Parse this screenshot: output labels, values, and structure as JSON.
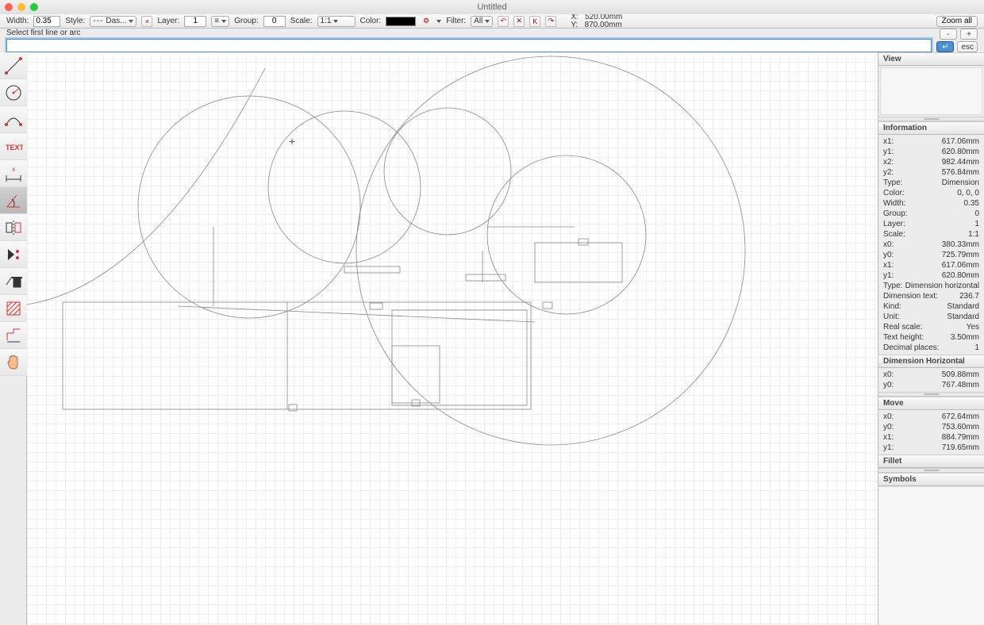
{
  "title": "Untitled",
  "toolbar": {
    "width_label": "Width:",
    "width_value": "0.35",
    "style_label": "Style:",
    "style_value": "Das...",
    "layer_label": "Layer:",
    "layer_value": "1",
    "group_label": "Group:",
    "group_value": "0",
    "scale_label": "Scale:",
    "scale_value": "1:1",
    "color_label": "Color:",
    "filter_label": "Filter:",
    "filter_value": "All",
    "coord_x_label": "X:",
    "coord_x_value": "520.00mm",
    "coord_y_label": "Y:",
    "coord_y_value": "870.00mm",
    "zoom_all": "Zoom all"
  },
  "prompt": {
    "text": "Select first line or arc",
    "minus": "-",
    "plus": "+",
    "esc": "esc"
  },
  "tools": [
    {
      "name": "line-tool"
    },
    {
      "name": "arc-tool"
    },
    {
      "name": "curve-tool"
    },
    {
      "name": "text-tool"
    },
    {
      "name": "dimension-tool"
    },
    {
      "name": "dimension-angle-tool"
    },
    {
      "name": "mirror-tool"
    },
    {
      "name": "edit-tool"
    },
    {
      "name": "delete-tool"
    },
    {
      "name": "hatch-tool"
    },
    {
      "name": "trim-tool"
    },
    {
      "name": "pan-tool"
    }
  ],
  "panels": {
    "view": "View",
    "information": "Information",
    "dimension_horizontal": "Dimension Horizontal",
    "move": "Move",
    "fillet": "Fillet",
    "symbols": "Symbols"
  },
  "info": [
    {
      "k": "x1:",
      "v": "617.06mm"
    },
    {
      "k": "y1:",
      "v": "620.80mm"
    },
    {
      "k": "x2:",
      "v": "982.44mm"
    },
    {
      "k": "y2:",
      "v": "576.84mm"
    },
    {
      "k": "Type:",
      "v": "Dimension"
    },
    {
      "k": "Color:",
      "v": "0, 0, 0"
    },
    {
      "k": "Width:",
      "v": "0.35"
    },
    {
      "k": "Group:",
      "v": "0"
    },
    {
      "k": "Layer:",
      "v": "1"
    },
    {
      "k": "Scale:",
      "v": "1:1"
    },
    {
      "k": "x0:",
      "v": "380.33mm"
    },
    {
      "k": "y0:",
      "v": "725.79mm"
    },
    {
      "k": "x1:",
      "v": "617.06mm"
    },
    {
      "k": "y1:",
      "v": "620.80mm"
    },
    {
      "k": "Type:",
      "v": "Dimension horizontal"
    },
    {
      "k": "Dimension text:",
      "v": "236.7"
    },
    {
      "k": "Kind:",
      "v": "Standard"
    },
    {
      "k": "Unit:",
      "v": "Standard"
    },
    {
      "k": "Real scale:",
      "v": "Yes"
    },
    {
      "k": "Text height:",
      "v": "3.50mm"
    },
    {
      "k": "Decimal places:",
      "v": "1"
    }
  ],
  "dim_h": [
    {
      "k": "x0:",
      "v": "509.88mm"
    },
    {
      "k": "y0:",
      "v": "767.48mm"
    }
  ],
  "move": [
    {
      "k": "x0:",
      "v": "672.64mm"
    },
    {
      "k": "y0:",
      "v": "753.60mm"
    },
    {
      "k": "x1:",
      "v": "884.79mm"
    },
    {
      "k": "y1:",
      "v": "719.65mm"
    }
  ]
}
